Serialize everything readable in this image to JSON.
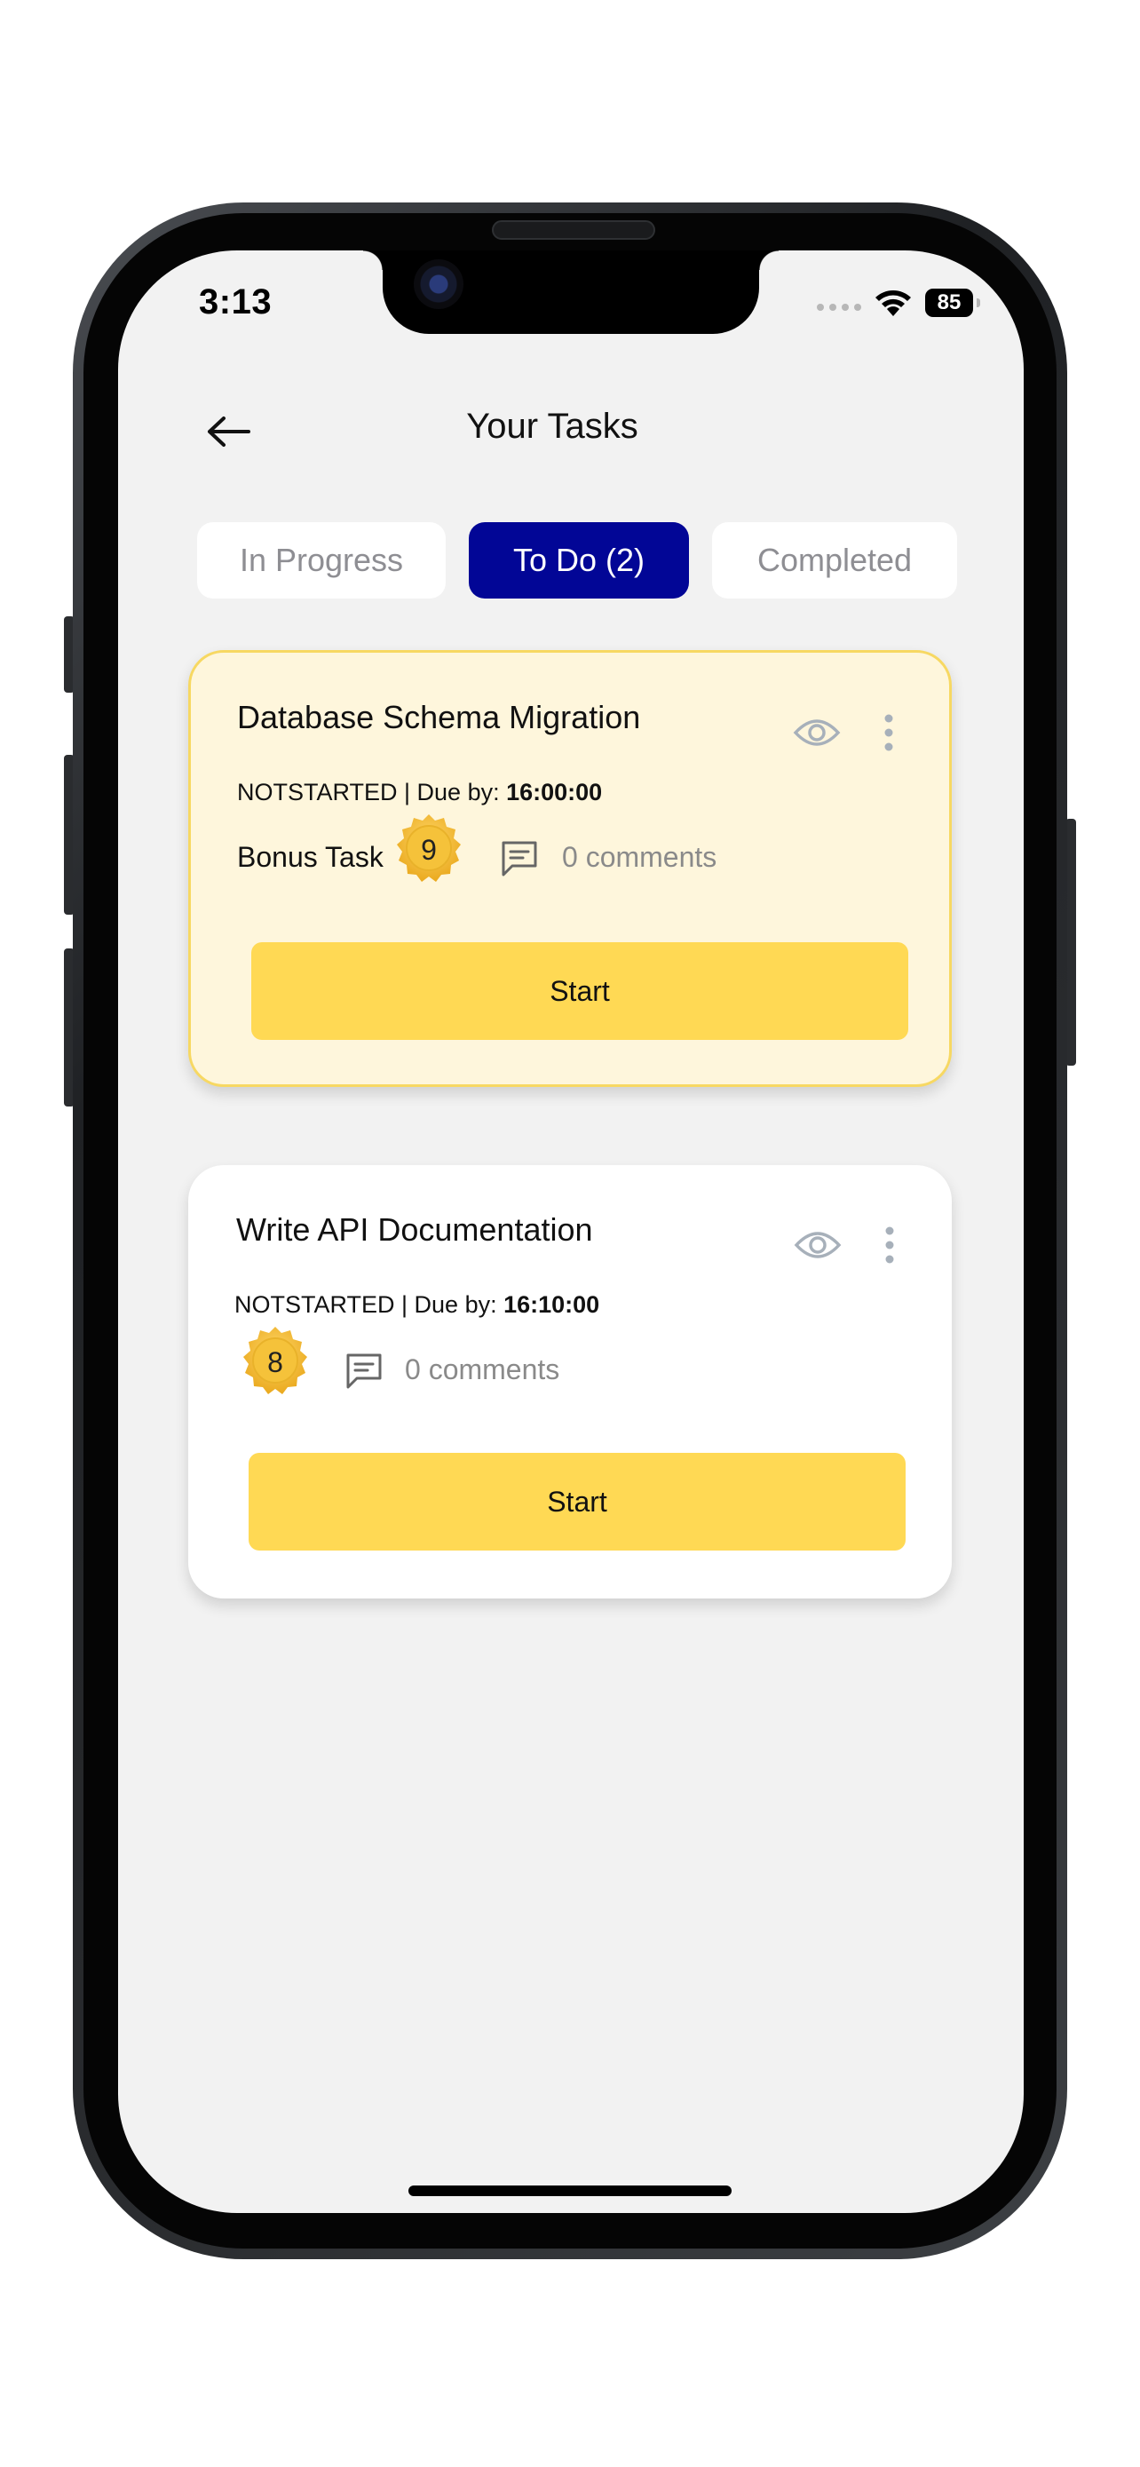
{
  "status_bar": {
    "time": "3:13",
    "battery": "85",
    "icons": [
      "cellular-signal-icon",
      "wifi-icon",
      "battery-icon"
    ]
  },
  "header": {
    "back_icon": "arrow-left-icon",
    "title": "Your Tasks"
  },
  "tabs": [
    {
      "label": "In Progress",
      "active": false
    },
    {
      "label": "To Do (2)",
      "active": true
    },
    {
      "label": "Completed",
      "active": false
    }
  ],
  "tasks": [
    {
      "title": "Database Schema Migration",
      "status": "NOTSTARTED",
      "due_prefix": " | Due by: ",
      "due_time": "16:00:00",
      "bonus_label": "Bonus Task",
      "points": "9",
      "comments": "0 comments",
      "button_label": "Start",
      "highlighted": true
    },
    {
      "title": "Write API Documentation",
      "status": "NOTSTARTED",
      "due_prefix": " | Due by: ",
      "due_time": "16:10:00",
      "points": "8",
      "comments": "0 comments",
      "button_label": "Start",
      "highlighted": false
    }
  ],
  "colors": {
    "accent": "#020696",
    "button": "#ffd954",
    "highlight_card_bg": "#fef6dc",
    "highlight_card_border": "#f7d862",
    "muted_text": "#8a8a8a",
    "screen_bg": "#f2f2f2"
  }
}
